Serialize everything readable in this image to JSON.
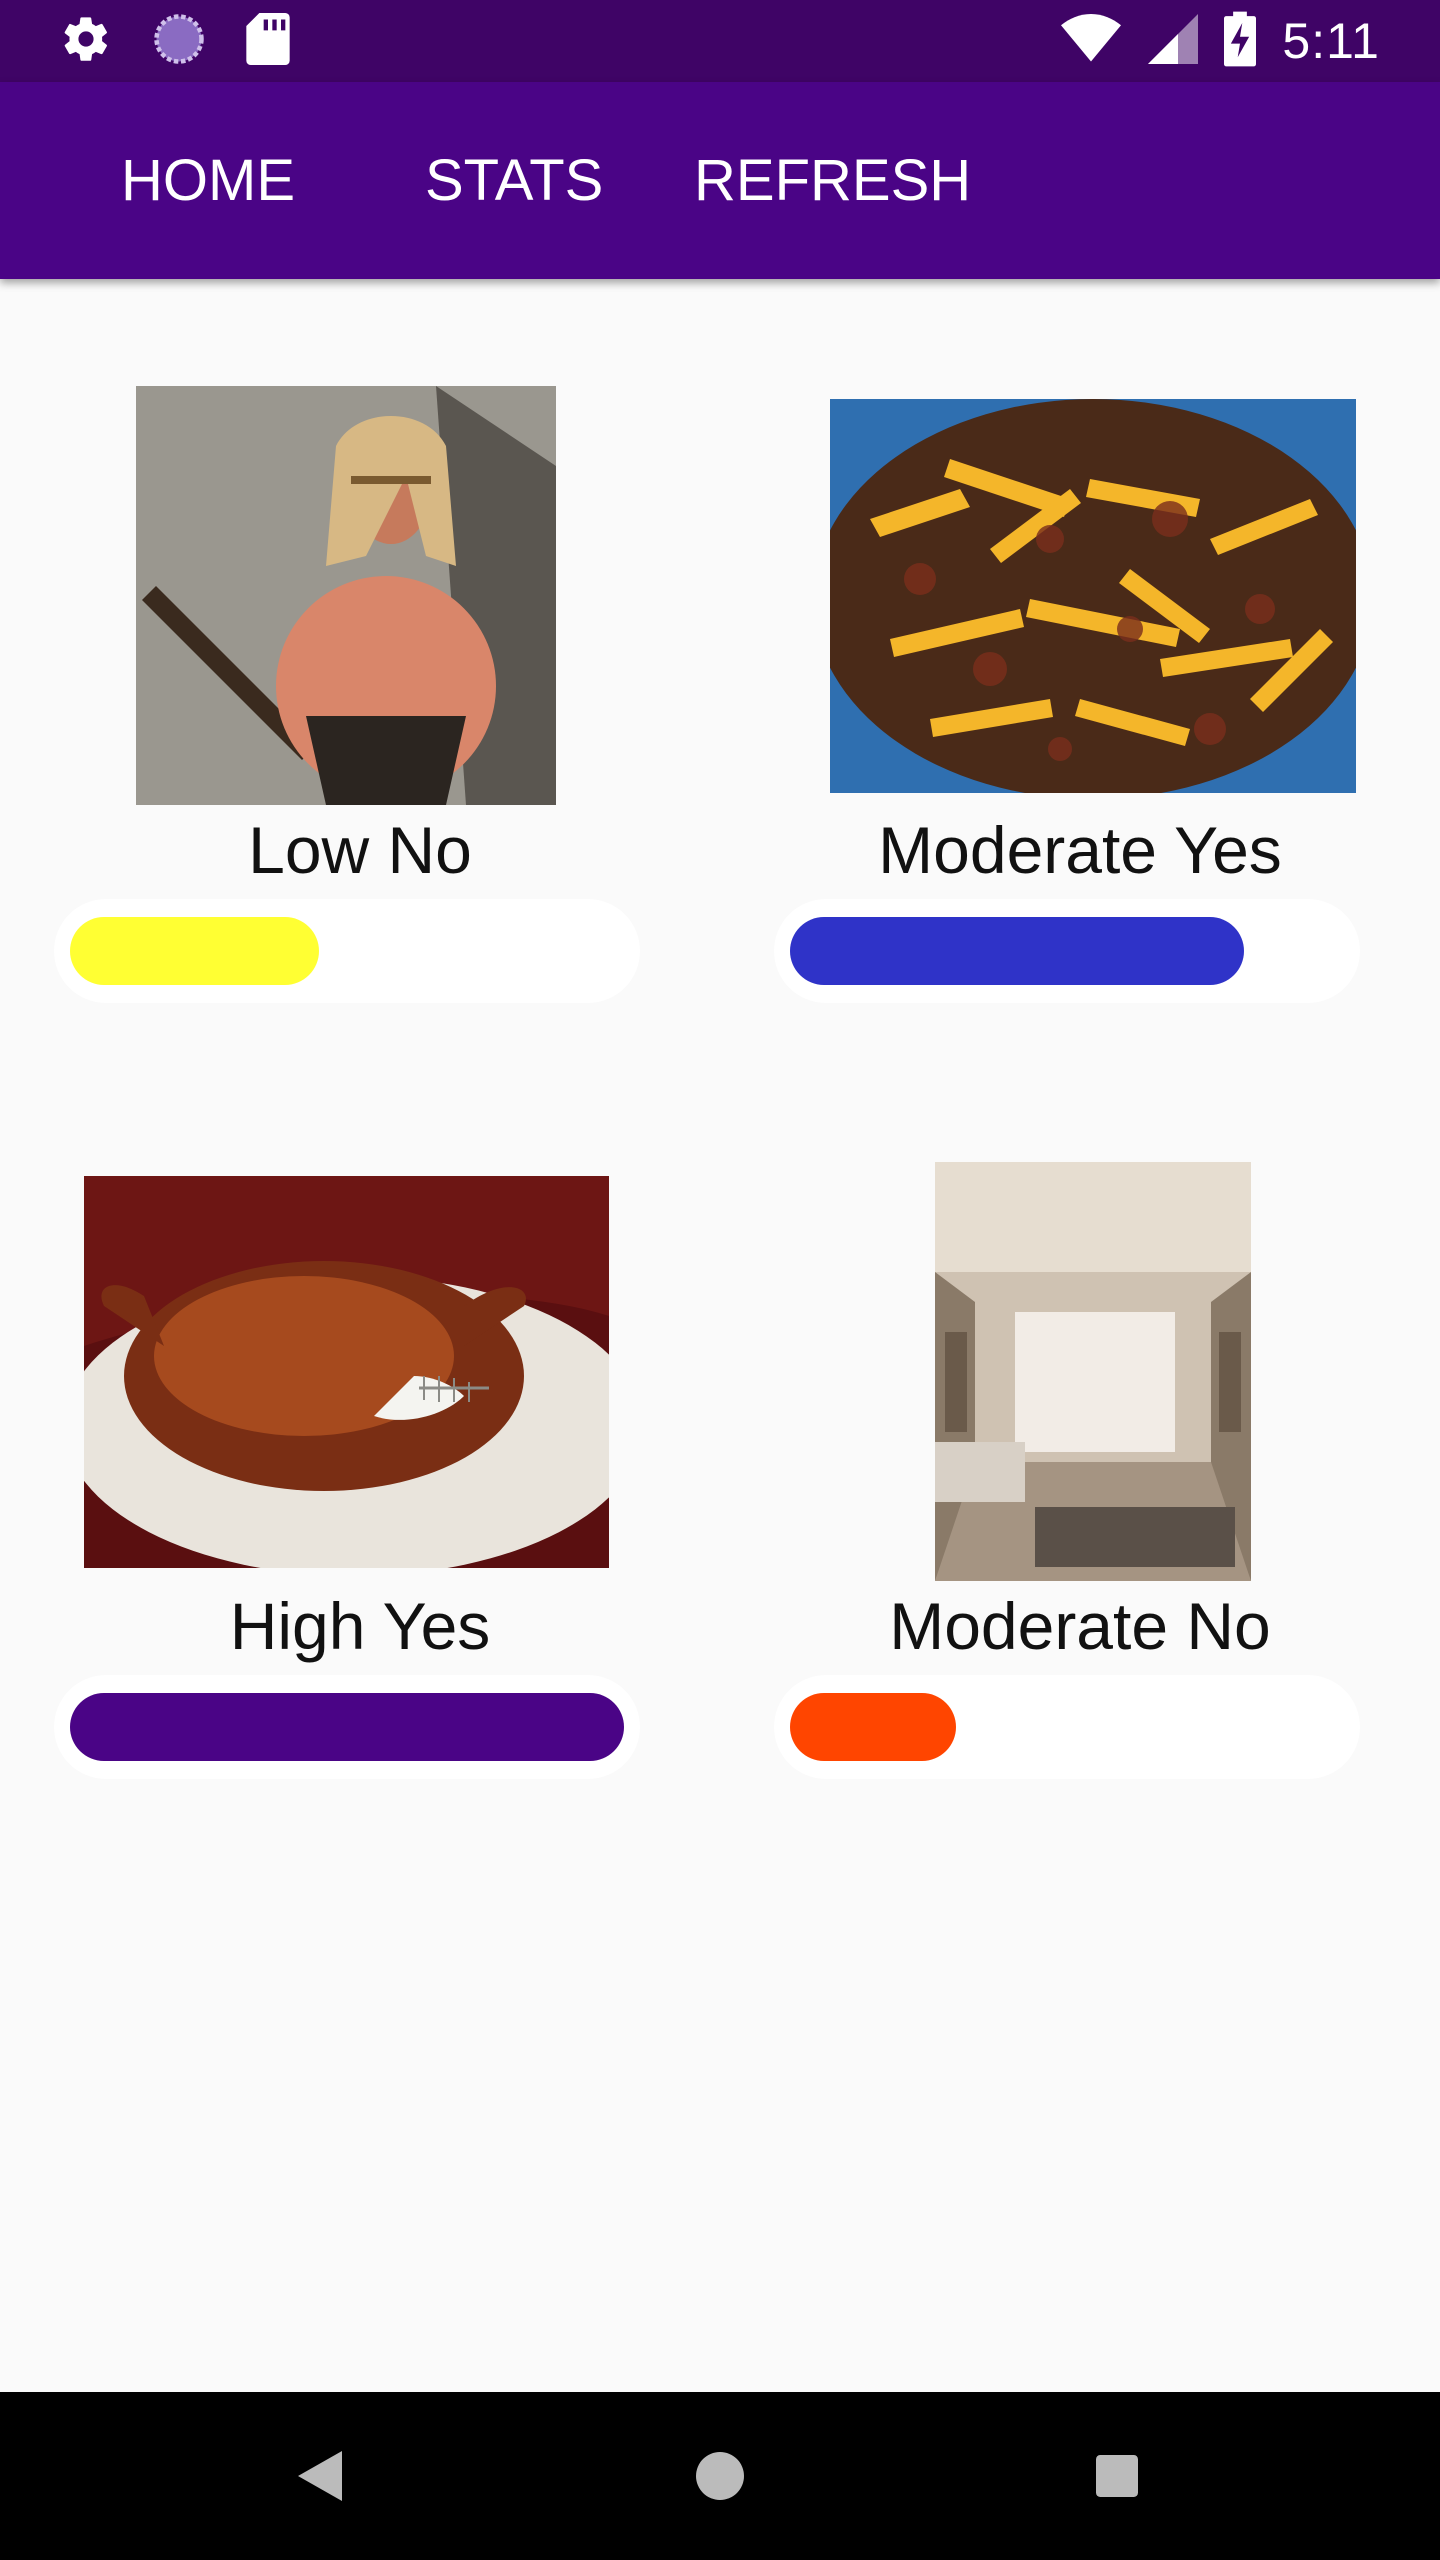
{
  "status_bar": {
    "icons": [
      "settings-icon",
      "sync-icon",
      "sd-card-icon",
      "wifi-icon",
      "signal-icon",
      "battery-charging-icon"
    ],
    "time": "5:11"
  },
  "app_bar": {
    "tabs": [
      {
        "label": "HOME"
      },
      {
        "label": "STATS"
      },
      {
        "label": "REFRESH"
      }
    ],
    "background": "#4a0486"
  },
  "cards": [
    {
      "image": "barbarian-photo",
      "label": "Low No",
      "level": 0.45,
      "bar_color": "#ffff33"
    },
    {
      "image": "loaded-fries-photo",
      "label": "Moderate Yes",
      "level": 0.82,
      "bar_color": "#2f33c8"
    },
    {
      "image": "roast-turkey-photo",
      "label": "High Yes",
      "level": 1.0,
      "bar_color": "#4a0486"
    },
    {
      "image": "living-room-photo",
      "label": "Moderate No",
      "level": 0.3,
      "bar_color": "#ff4500"
    }
  ],
  "nav_bar": {
    "buttons": [
      "back-icon",
      "home-icon",
      "recents-icon"
    ]
  }
}
